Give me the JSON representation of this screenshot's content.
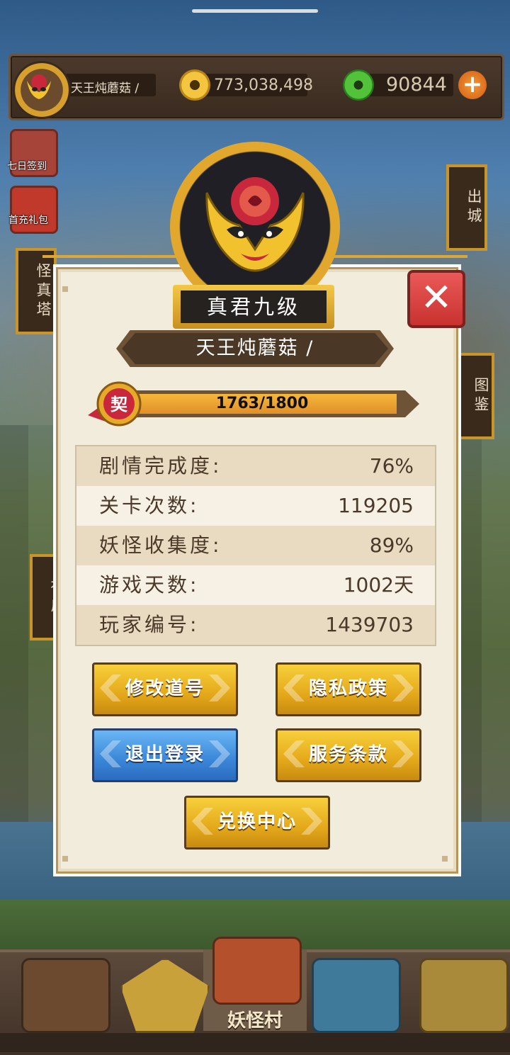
{
  "top_bar": {
    "player_name": "天王炖蘑菇 /",
    "coins": "773,038,498",
    "jade": "90844",
    "add_symbol": "+"
  },
  "side_icons": {
    "seven_day_signin": "七日签到",
    "first_charge_gift": "首充礼包",
    "monster_tower": "怪真塔",
    "leave_city": "出城",
    "codex": "图鉴",
    "shrine": "神庙"
  },
  "profile": {
    "rank": "真君九级",
    "name": "天王炖蘑菇 /",
    "contract_badge": "契",
    "xp_text": "1763/1800",
    "xp_current": 1763,
    "xp_max": 1800,
    "close_symbol": "✕",
    "stats": [
      {
        "label": "剧情完成度:",
        "value": "76%"
      },
      {
        "label": "关卡次数:",
        "value": "119205"
      },
      {
        "label": "妖怪收集度:",
        "value": "89%"
      },
      {
        "label": "游戏天数:",
        "value": "1002天"
      },
      {
        "label": "玩家编号:",
        "value": "1439703"
      }
    ],
    "buttons": {
      "change_name": "修改道号",
      "privacy": "隐私政策",
      "logout": "退出登录",
      "terms": "服务条款",
      "redeem": "兑换中心"
    }
  },
  "bottom_nav": {
    "active_label": "妖怪村"
  },
  "colors": {
    "gold_button": "#e4a91a",
    "blue_button": "#3a86d8",
    "close_red": "#d8403d",
    "panel_bg": "#f1ecdb"
  }
}
